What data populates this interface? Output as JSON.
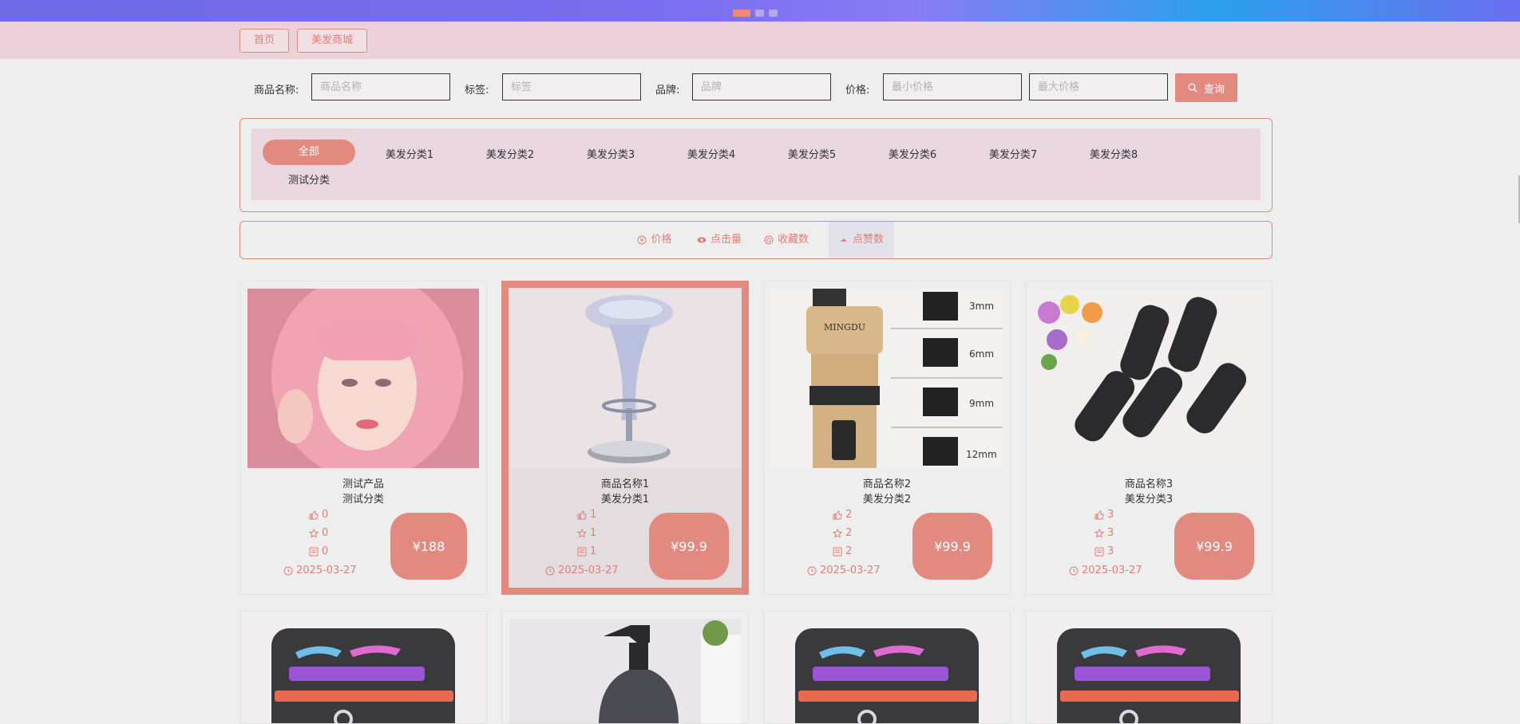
{
  "breadcrumb": [
    {
      "label": "首页"
    },
    {
      "label": "美发商城"
    }
  ],
  "search": {
    "name_label": "商品名称:",
    "name_placeholder": "商品名称",
    "tag_label": "标签:",
    "tag_placeholder": "标签",
    "brand_label": "品牌:",
    "brand_placeholder": "品牌",
    "price_label": "价格:",
    "min_placeholder": "最小价格",
    "max_placeholder": "最大价格",
    "query_label": "查询"
  },
  "categories": [
    "全部",
    "美发分类1",
    "美发分类2",
    "美发分类3",
    "美发分类4",
    "美发分类5",
    "美发分类6",
    "美发分类7",
    "美发分类8",
    "测试分类"
  ],
  "sort": [
    {
      "label": "价格",
      "icon": "price-icon"
    },
    {
      "label": "点击量",
      "icon": "eye-icon"
    },
    {
      "label": "收藏数",
      "icon": "star-circle-icon"
    },
    {
      "label": "点赞数",
      "icon": "caret-up-icon"
    }
  ],
  "products": [
    {
      "name": "测试产品",
      "category": "测试分类",
      "likes": "0",
      "favorites": "0",
      "comments": "0",
      "price": "¥188",
      "date": "2025-03-27"
    },
    {
      "name": "商品名称1",
      "category": "美发分类1",
      "likes": "1",
      "favorites": "1",
      "comments": "1",
      "price": "¥99.9",
      "date": "2025-03-27"
    },
    {
      "name": "商品名称2",
      "category": "美发分类2",
      "likes": "2",
      "favorites": "2",
      "comments": "2",
      "price": "¥99.9",
      "date": "2025-03-27"
    },
    {
      "name": "商品名称3",
      "category": "美发分类3",
      "likes": "3",
      "favorites": "3",
      "comments": "3",
      "price": "¥99.9",
      "date": "2025-03-27"
    }
  ],
  "clipper_labels": [
    "3mm",
    "6mm",
    "9mm",
    "12mm"
  ],
  "clipper_brand": "MINGDU",
  "colors": {
    "accent": "#e38a80",
    "breadcrumb_bg": "#ecd1da",
    "category_bg": "#e9d6de"
  }
}
